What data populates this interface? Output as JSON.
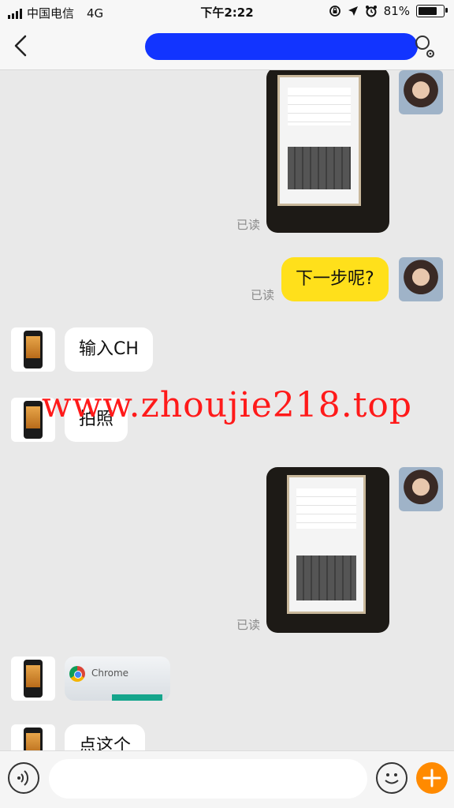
{
  "status_bar": {
    "carrier": "中国电信",
    "network": "4G",
    "time": "下午2:22",
    "battery": "81%",
    "battery_level": 0.81
  },
  "nav": {
    "back_icon": "chevron-left-icon",
    "profile_icon": "person-settings-icon"
  },
  "messages": [
    {
      "from": "me",
      "type": "image",
      "read_label": "已读"
    },
    {
      "from": "me",
      "type": "text",
      "text": "下一步呢?",
      "read_label": "已读"
    },
    {
      "from": "other",
      "type": "text",
      "text": "输入CH"
    },
    {
      "from": "other",
      "type": "text",
      "text": "拍照"
    },
    {
      "from": "me",
      "type": "image",
      "read_label": "已读"
    },
    {
      "from": "other",
      "type": "image",
      "caption": "Chrome"
    },
    {
      "from": "other",
      "type": "text",
      "text": "点这个"
    }
  ],
  "watermark": "www.zhoujie218.top",
  "input_bar": {
    "voice_icon": "voice-icon",
    "emoji_icon": "emoji-icon",
    "plus_icon": "plus-icon",
    "placeholder": ""
  },
  "colors": {
    "bubble_mine": "#ffe01b",
    "plus_button": "#ff8a00",
    "title_redaction": "#1234ff",
    "watermark": "#ff1a1a"
  }
}
